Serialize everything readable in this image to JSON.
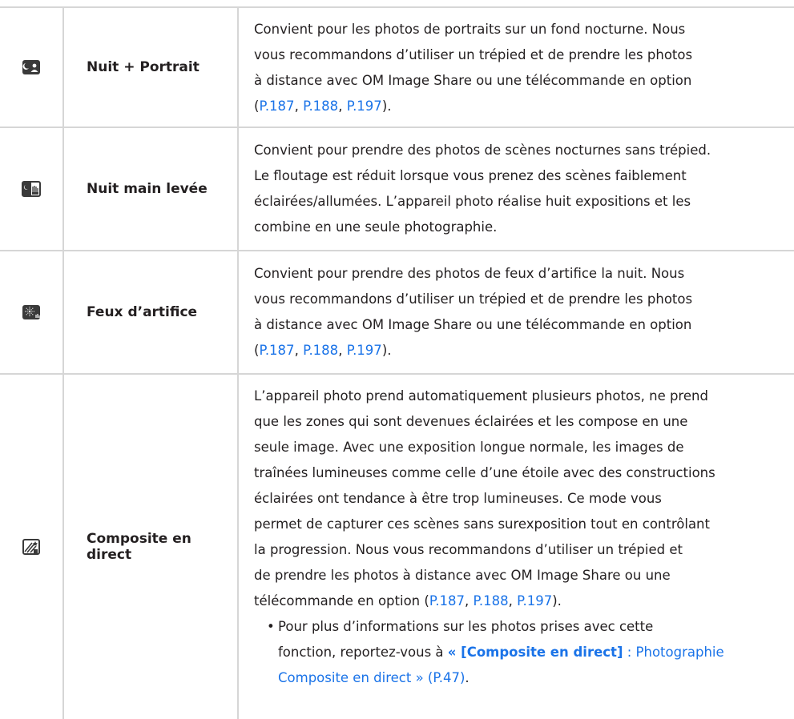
{
  "rows": [
    {
      "icon": "night-portrait-icon",
      "name": "Nuit + Portrait",
      "lines": [
        "Convient pour les photos de portraits sur un fond nocturne. Nous",
        "vous recommandons d’utiliser un trépied et de prendre les photos",
        "à distance avec OM Image Share ou une télécommande en option"
      ],
      "ref_open": "(",
      "ref_sep": ", ",
      "ref_close": ").",
      "refs": [
        "P.187",
        "P.188",
        "P.197"
      ]
    },
    {
      "icon": "handheld-night-icon",
      "name": "Nuit main levée",
      "lines": [
        "Convient pour prendre des photos de scènes nocturnes sans trépied.",
        "Le floutage est réduit lorsque vous prenez des scènes faiblement",
        "éclairées/allumées. L’appareil photo réalise huit expositions et les",
        "combine en une seule photographie."
      ]
    },
    {
      "icon": "fireworks-icon",
      "name": "Feux d’artifice",
      "lines": [
        "Convient pour prendre des photos de feux d’artifice la nuit. Nous",
        "vous recommandons d’utiliser un trépied et de prendre les photos",
        "à distance avec OM Image Share ou une télécommande en option"
      ],
      "ref_open": "(",
      "ref_sep": ", ",
      "ref_close": ").",
      "refs": [
        "P.187",
        "P.188",
        "P.197"
      ]
    },
    {
      "icon": "live-composite-icon",
      "name": "Composite en direct",
      "lines": [
        "L’appareil photo prend automatiquement plusieurs photos, ne prend",
        "que les zones qui sont devenues éclairées et les compose en une",
        "seule image. Avec une exposition longue normale, les images de",
        "traînées lumineuses comme celle d’une étoile avec des constructions",
        "éclairées ont tendance à être trop lumineuses. Ce mode vous",
        "permet de capturer ces scènes sans surexposition tout en contrôlant",
        "la progression. Nous vous recommandons d’utiliser un trépied et",
        "de prendre les photos à distance avec OM Image Share ou une"
      ],
      "last_line_text": "télécommande en option (",
      "ref_sep": ", ",
      "ref_close": ").",
      "refs": [
        "P.187",
        "P.188",
        "P.197"
      ],
      "bullet": {
        "mark": "•",
        "line1": "Pour plus d’informations sur les photos prises avec cette",
        "line2_prefix": "fonction, reportez-vous à ",
        "link_bold": "« [Composite en direct]",
        "link_rest_1": " : Photographie",
        "link_rest_2": "Composite en direct » (P.47)",
        "end": "."
      }
    }
  ]
}
